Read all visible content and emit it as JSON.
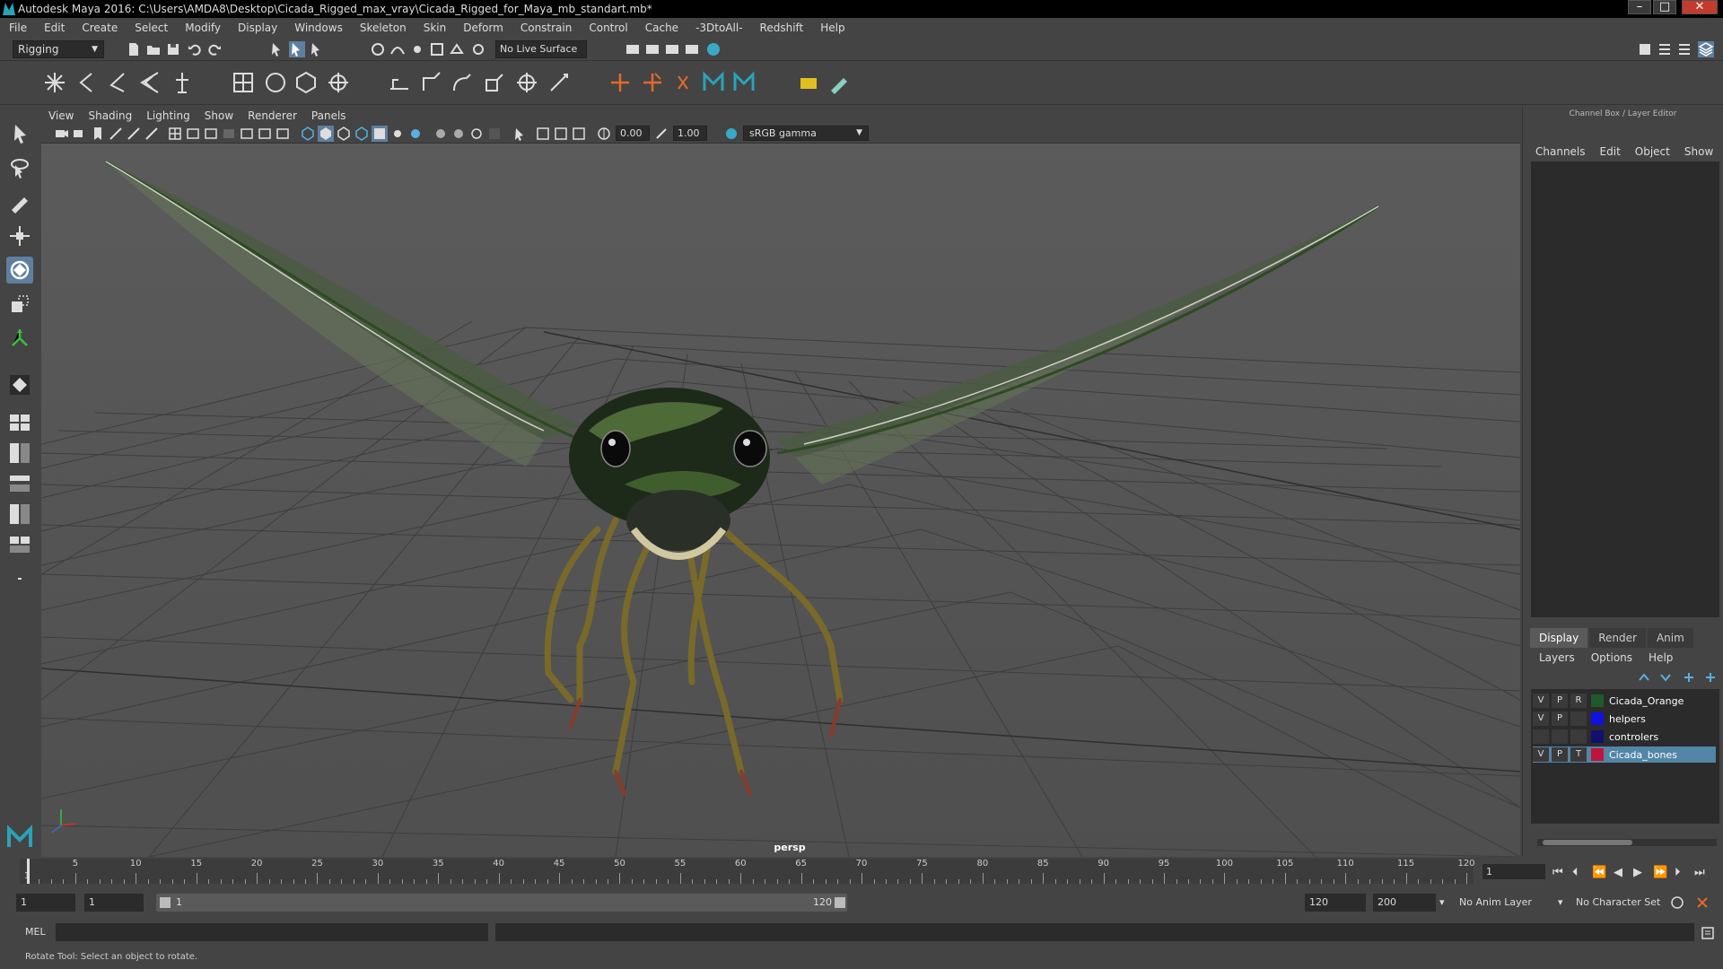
{
  "window": {
    "title": "Autodesk Maya 2016: C:\\Users\\AMDA8\\Desktop\\Cicada_Rigged_max_vray\\Cicada_Rigged_for_Maya_mb_standart.mb*",
    "minimize": "–",
    "maximize": "□",
    "close": "✕"
  },
  "menu": [
    "File",
    "Edit",
    "Create",
    "Select",
    "Modify",
    "Display",
    "Windows",
    "Skeleton",
    "Skin",
    "Deform",
    "Constrain",
    "Control",
    "Cache",
    "-3DtoAll-",
    "Redshift",
    "Help"
  ],
  "status_line": {
    "mode": "Rigging",
    "live_surface": "No Live Surface"
  },
  "panel_menu": [
    "View",
    "Shading",
    "Lighting",
    "Show",
    "Renderer",
    "Panels"
  ],
  "panel_toolbar": {
    "exposure": "0.00",
    "gamma": "1.00",
    "color_space": "sRGB gamma"
  },
  "viewport": {
    "camera": "persp"
  },
  "channel_box": {
    "title": "Channel Box / Layer Editor",
    "menu": [
      "Channels",
      "Edit",
      "Object",
      "Show"
    ]
  },
  "layer_editor": {
    "tabs": [
      "Display",
      "Render",
      "Anim"
    ],
    "active_tab": "Display",
    "menu": [
      "Layers",
      "Options",
      "Help"
    ],
    "layers": [
      {
        "v": "V",
        "p": "P",
        "r": "R",
        "name": "Cicada_Orange",
        "color": "#1f5a2a",
        "selected": false
      },
      {
        "v": "V",
        "p": "P",
        "r": "",
        "name": "helpers",
        "color": "#1010e0",
        "selected": false
      },
      {
        "v": "",
        "p": "",
        "r": "",
        "name": "controlers",
        "color": "#101070",
        "selected": false
      },
      {
        "v": "V",
        "p": "P",
        "r": "T",
        "name": "Cicada_bones",
        "color": "#c0143c",
        "selected": true
      }
    ]
  },
  "timeline": {
    "start_label": "1",
    "ticks": [
      5,
      10,
      15,
      20,
      25,
      30,
      35,
      40,
      45,
      50,
      55,
      60,
      65,
      70,
      75,
      80,
      85,
      90,
      95,
      100,
      105,
      110,
      115,
      120
    ],
    "min": 1,
    "max": 120,
    "current_frame": "1"
  },
  "range": {
    "start": "1",
    "playback_start": "1",
    "slider_start": "1",
    "slider_end": "120",
    "playback_end": "120",
    "end": "200",
    "anim_layer": "No Anim Layer",
    "character_set": "No Character Set"
  },
  "command_line": {
    "label": "MEL"
  },
  "help_line": "Rotate Tool: Select an object to rotate."
}
